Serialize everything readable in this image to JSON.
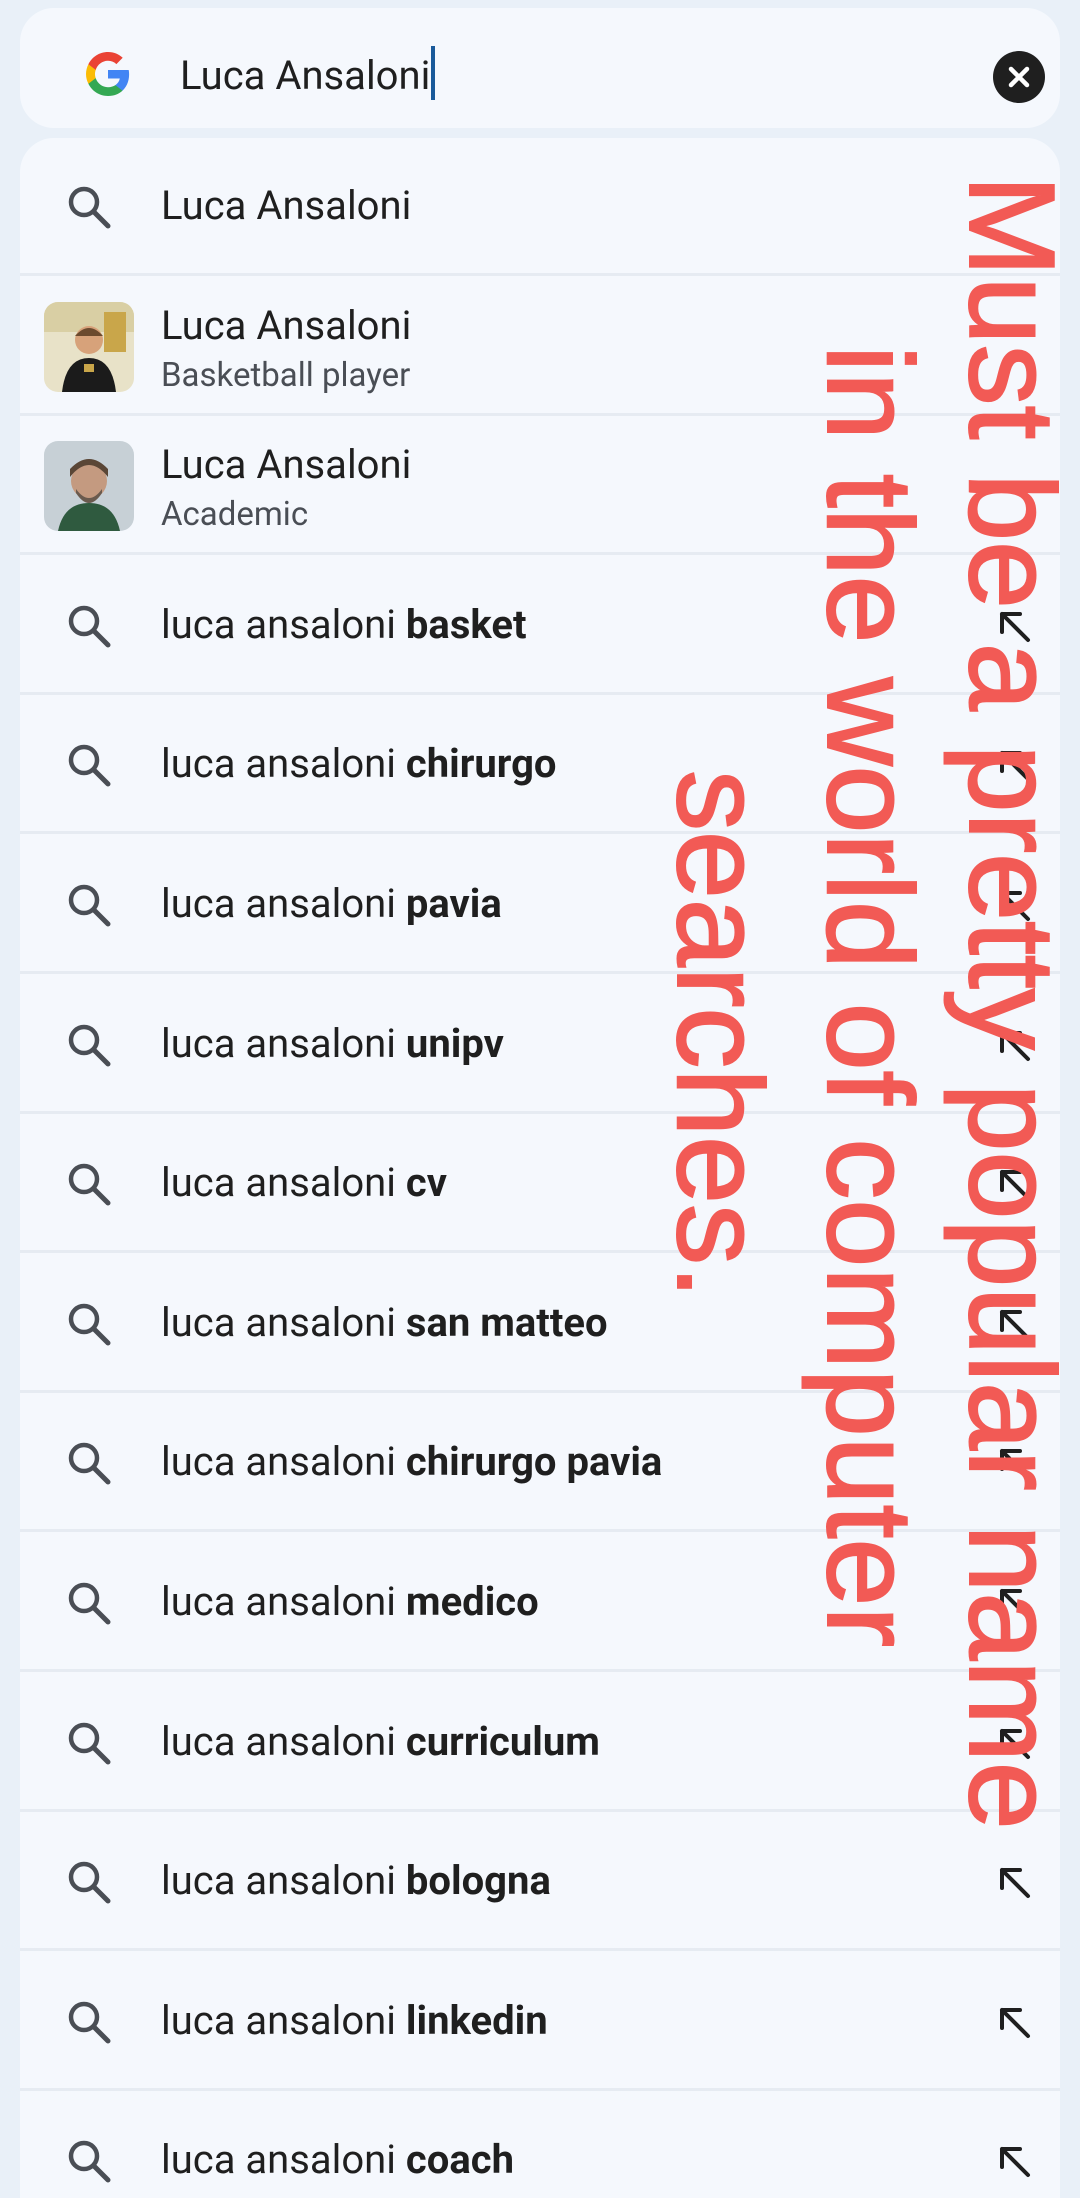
{
  "search": {
    "query": "Luca Ansaloni"
  },
  "suggestions": [
    {
      "prefix": "Luca Ansaloni",
      "bold": "",
      "fill_arrow": false
    },
    {
      "entity": true,
      "title": "Luca Ansaloni",
      "subtitle": "Basketball player"
    },
    {
      "entity": true,
      "title": "Luca Ansaloni",
      "subtitle": "Academic"
    },
    {
      "prefix": "luca ansaloni ",
      "bold": "basket",
      "fill_arrow": true
    },
    {
      "prefix": "luca ansaloni ",
      "bold": "chirurgo",
      "fill_arrow": true
    },
    {
      "prefix": "luca ansaloni ",
      "bold": "pavia",
      "fill_arrow": true
    },
    {
      "prefix": "luca ansaloni ",
      "bold": "unipv",
      "fill_arrow": true
    },
    {
      "prefix": "luca ansaloni ",
      "bold": "cv",
      "fill_arrow": true
    },
    {
      "prefix": "luca ansaloni ",
      "bold": "san matteo",
      "fill_arrow": true
    },
    {
      "prefix": "luca ansaloni ",
      "bold": "chirurgo pavia",
      "fill_arrow": true
    },
    {
      "prefix": "luca ansaloni ",
      "bold": "medico",
      "fill_arrow": true
    },
    {
      "prefix": "luca ansaloni ",
      "bold": "curriculum",
      "fill_arrow": true
    },
    {
      "prefix": "luca ansaloni ",
      "bold": "bologna",
      "fill_arrow": true
    },
    {
      "prefix": "luca ansaloni ",
      "bold": "linkedin",
      "fill_arrow": true
    },
    {
      "prefix": "luca ansaloni ",
      "bold": "coach",
      "fill_arrow": true
    }
  ],
  "annotation": {
    "lines": [
      "Must be a pretty popular name",
      "in the world of computer",
      "searches."
    ],
    "color": "#f25a55"
  },
  "colors": {
    "background": "#e9f0f8",
    "surface": "#f5f8fd",
    "caret": "#1a5a9a"
  }
}
